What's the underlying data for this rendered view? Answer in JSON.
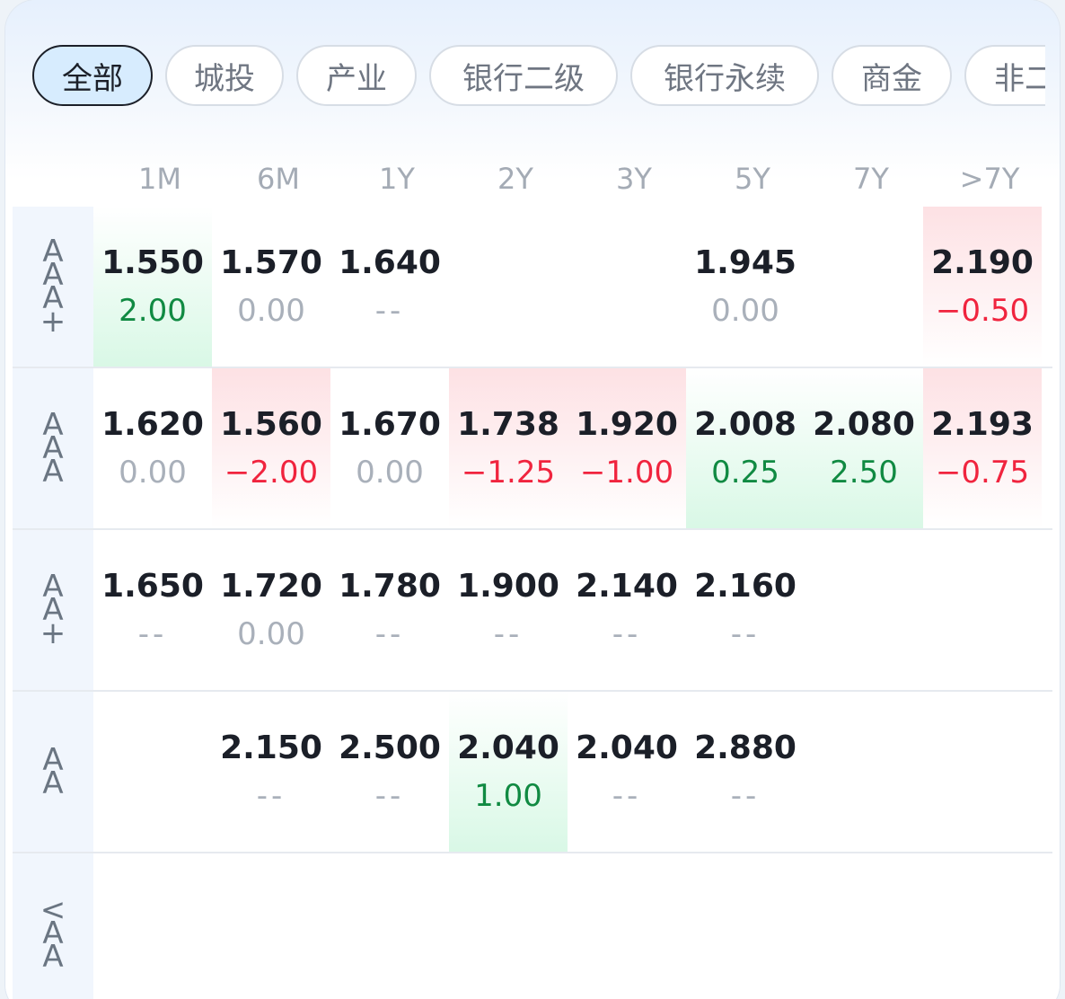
{
  "tabs": [
    "全部",
    "城投",
    "产业",
    "银行二级",
    "银行永续",
    "商金",
    "非二"
  ],
  "active_tab": "全部",
  "columns": [
    "1M",
    "6M",
    "1Y",
    "2Y",
    "3Y",
    "5Y",
    "7Y",
    ">7Y"
  ],
  "rows": [
    {
      "label": [
        "A",
        "A",
        "A",
        "+"
      ],
      "cells": [
        {
          "value": "1.550",
          "change": "2.00",
          "trend": "up",
          "bg": "green"
        },
        {
          "value": "1.570",
          "change": "0.00",
          "trend": "flat",
          "bg": ""
        },
        {
          "value": "1.640",
          "change": "--",
          "trend": "na",
          "bg": ""
        },
        {
          "value": "",
          "change": "",
          "trend": "",
          "bg": ""
        },
        {
          "value": "",
          "change": "",
          "trend": "",
          "bg": ""
        },
        {
          "value": "1.945",
          "change": "0.00",
          "trend": "flat",
          "bg": ""
        },
        {
          "value": "",
          "change": "",
          "trend": "",
          "bg": ""
        },
        {
          "value": "2.190",
          "change": "−0.50",
          "trend": "down",
          "bg": "red"
        }
      ]
    },
    {
      "label": [
        "A",
        "A",
        "A"
      ],
      "cells": [
        {
          "value": "1.620",
          "change": "0.00",
          "trend": "flat",
          "bg": ""
        },
        {
          "value": "1.560",
          "change": "−2.00",
          "trend": "down",
          "bg": "red"
        },
        {
          "value": "1.670",
          "change": "0.00",
          "trend": "flat",
          "bg": ""
        },
        {
          "value": "1.738",
          "change": "−1.25",
          "trend": "down",
          "bg": "red"
        },
        {
          "value": "1.920",
          "change": "−1.00",
          "trend": "down",
          "bg": "red"
        },
        {
          "value": "2.008",
          "change": "0.25",
          "trend": "up",
          "bg": "green"
        },
        {
          "value": "2.080",
          "change": "2.50",
          "trend": "up",
          "bg": "green"
        },
        {
          "value": "2.193",
          "change": "−0.75",
          "trend": "down",
          "bg": "red"
        }
      ]
    },
    {
      "label": [
        "A",
        "A",
        "+"
      ],
      "cells": [
        {
          "value": "1.650",
          "change": "--",
          "trend": "na",
          "bg": ""
        },
        {
          "value": "1.720",
          "change": "0.00",
          "trend": "flat",
          "bg": ""
        },
        {
          "value": "1.780",
          "change": "--",
          "trend": "na",
          "bg": ""
        },
        {
          "value": "1.900",
          "change": "--",
          "trend": "na",
          "bg": ""
        },
        {
          "value": "2.140",
          "change": "--",
          "trend": "na",
          "bg": ""
        },
        {
          "value": "2.160",
          "change": "--",
          "trend": "na",
          "bg": ""
        },
        {
          "value": "",
          "change": "",
          "trend": "",
          "bg": ""
        },
        {
          "value": "",
          "change": "",
          "trend": "",
          "bg": ""
        }
      ]
    },
    {
      "label": [
        "A",
        "A"
      ],
      "cells": [
        {
          "value": "",
          "change": "",
          "trend": "",
          "bg": ""
        },
        {
          "value": "2.150",
          "change": "--",
          "trend": "na",
          "bg": ""
        },
        {
          "value": "2.500",
          "change": "--",
          "trend": "na",
          "bg": ""
        },
        {
          "value": "2.040",
          "change": "1.00",
          "trend": "up",
          "bg": "green"
        },
        {
          "value": "2.040",
          "change": "--",
          "trend": "na",
          "bg": ""
        },
        {
          "value": "2.880",
          "change": "--",
          "trend": "na",
          "bg": ""
        },
        {
          "value": "",
          "change": "",
          "trend": "",
          "bg": ""
        },
        {
          "value": "",
          "change": "",
          "trend": "",
          "bg": ""
        }
      ]
    },
    {
      "label": [
        "<",
        "A",
        "A"
      ],
      "cells": [
        {
          "value": "",
          "change": "",
          "trend": "",
          "bg": ""
        },
        {
          "value": "",
          "change": "",
          "trend": "",
          "bg": ""
        },
        {
          "value": "",
          "change": "",
          "trend": "",
          "bg": ""
        },
        {
          "value": "",
          "change": "",
          "trend": "",
          "bg": ""
        },
        {
          "value": "",
          "change": "",
          "trend": "",
          "bg": ""
        },
        {
          "value": "",
          "change": "",
          "trend": "",
          "bg": ""
        },
        {
          "value": "",
          "change": "",
          "trend": "",
          "bg": ""
        },
        {
          "value": "",
          "change": "",
          "trend": "",
          "bg": ""
        }
      ]
    }
  ],
  "colors": {
    "up": "#108a42",
    "down": "#f0243e",
    "flat": "#a9b0ba",
    "active_tab_bg": "#d7ecfe"
  }
}
